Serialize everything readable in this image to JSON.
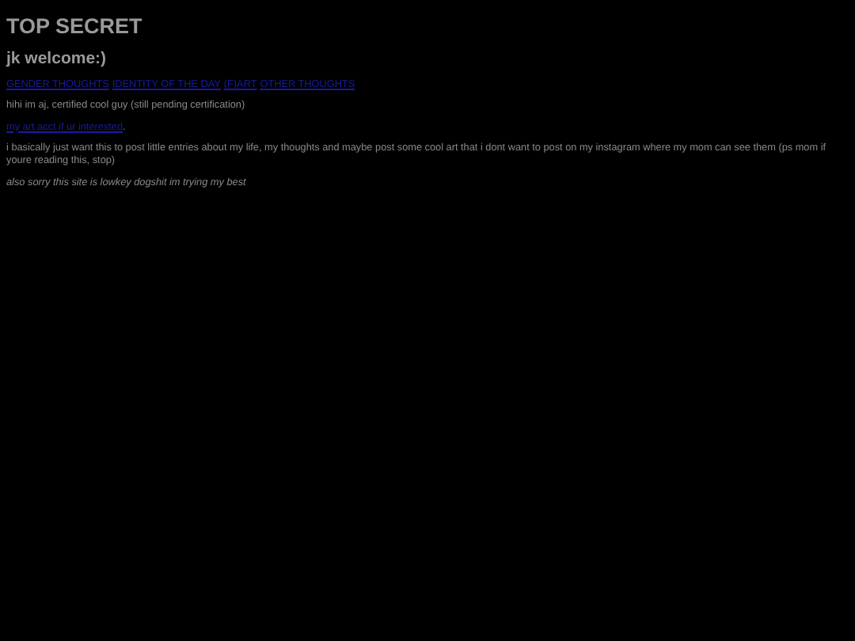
{
  "title": "TOP SECRET",
  "subtitle": "jk welcome:)",
  "nav_links": [
    "GENDER THOUGHTS",
    "IDENTITY OF THE DAY",
    "(F)ART",
    "OTHER THOUGHTS"
  ],
  "intro": "hihi im aj, certified cool guy (still pending certification)",
  "art_link": {
    "text": "my art acct if ur interested",
    "suffix": "."
  },
  "about": "i basically just want this to post little entries about my life, my thoughts and maybe post some cool art that i dont want to post on my instagram where my mom can see them (ps mom if youre reading this, stop)",
  "note": "also sorry this site is lowkey dogshit im trying my best"
}
